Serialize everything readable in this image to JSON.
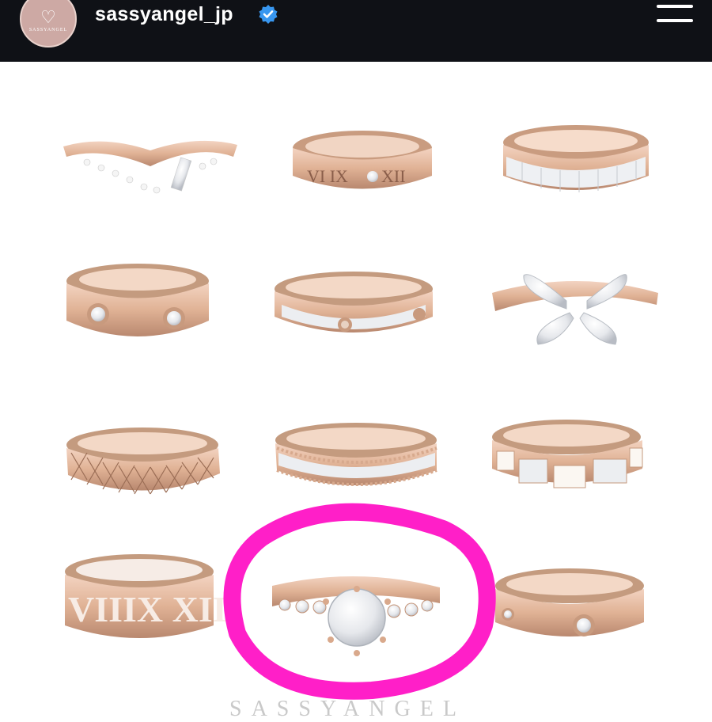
{
  "header": {
    "username": "sassyangel_jp",
    "avatar_brand": "SASSYANGEL",
    "verified": true,
    "menu_icon": "hamburger-menu-icon"
  },
  "post": {
    "rings": [
      {
        "name": "v-shape-diamond-ring"
      },
      {
        "name": "roman-numeral-ring"
      },
      {
        "name": "eternity-band-ring"
      },
      {
        "name": "screw-love-ring"
      },
      {
        "name": "pave-screw-ring"
      },
      {
        "name": "butterfly-ring"
      },
      {
        "name": "quilted-ring"
      },
      {
        "name": "beaded-pave-ring"
      },
      {
        "name": "mother-of-pearl-ring"
      },
      {
        "name": "cutout-roman-numeral-ring"
      },
      {
        "name": "solitaire-engagement-ring",
        "highlighted": true
      },
      {
        "name": "diamond-love-ring"
      }
    ],
    "watermark": "SASSYANGEL",
    "highlight_color": "#ff1fc8"
  },
  "colors": {
    "topbar": "#0f1116",
    "gold": "#e4b8a0",
    "gold_dark": "#b9886f",
    "verified_blue": "#3897f0"
  }
}
